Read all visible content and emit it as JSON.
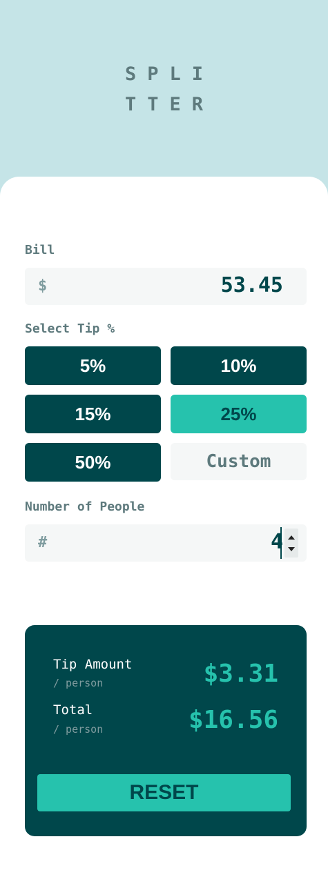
{
  "logo": {
    "line1": "SPLI",
    "line2": "TTER"
  },
  "bill": {
    "label": "Bill",
    "prefix": "$",
    "value": "53.45"
  },
  "tip": {
    "label": "Select Tip %",
    "options": [
      "5%",
      "10%",
      "15%",
      "25%",
      "50%"
    ],
    "selected": "25%",
    "custom_placeholder": "Custom"
  },
  "people": {
    "label": "Number of People",
    "prefix": "#",
    "value": "4"
  },
  "summary": {
    "tip_label": "Tip Amount",
    "tip_sub": "/ person",
    "tip_value": "$3.31",
    "total_label": "Total",
    "total_sub": "/ person",
    "total_value": "$16.56",
    "reset_label": "RESET"
  },
  "colors": {
    "background": "#c5e4e7",
    "dark_cyan": "#00474b",
    "accent": "#26c2ad",
    "grey": "#5e7a7d",
    "field_bg": "#f5f7f7"
  },
  "icons": {
    "stepper_up": "chevron-up-icon",
    "stepper_down": "chevron-down-icon"
  }
}
